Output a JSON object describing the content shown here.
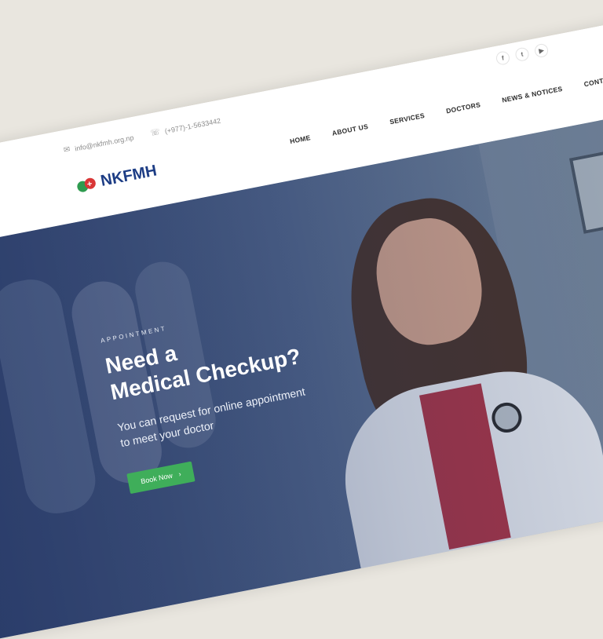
{
  "topbar": {
    "email": "info@nkfmh.org.np",
    "phone": "(+977)-1-5633442",
    "email_icon": "envelope-icon",
    "phone_icon": "phone-icon"
  },
  "social": {
    "facebook": "f",
    "twitter": "t",
    "youtube": "▶"
  },
  "logo": {
    "text": "NKFMH"
  },
  "nav": {
    "home": "HOME",
    "about": "ABOUT US",
    "services": "SERVICES",
    "doctors": "DOCTORS",
    "news": "NEWS & NOTICES",
    "contact": "CONTACT"
  },
  "hero": {
    "eyebrow": "APPOINTMENT",
    "title_line1": "Need a",
    "title_line2": "Medical Checkup?",
    "subtitle_line1": "You can request for online appointment",
    "subtitle_line2": "to meet your doctor",
    "button": "Book Now",
    "button_arrow": "›"
  },
  "colors": {
    "brand_blue": "#1d3d85",
    "button_green": "#3fae5a",
    "logo_red": "#d93636"
  }
}
